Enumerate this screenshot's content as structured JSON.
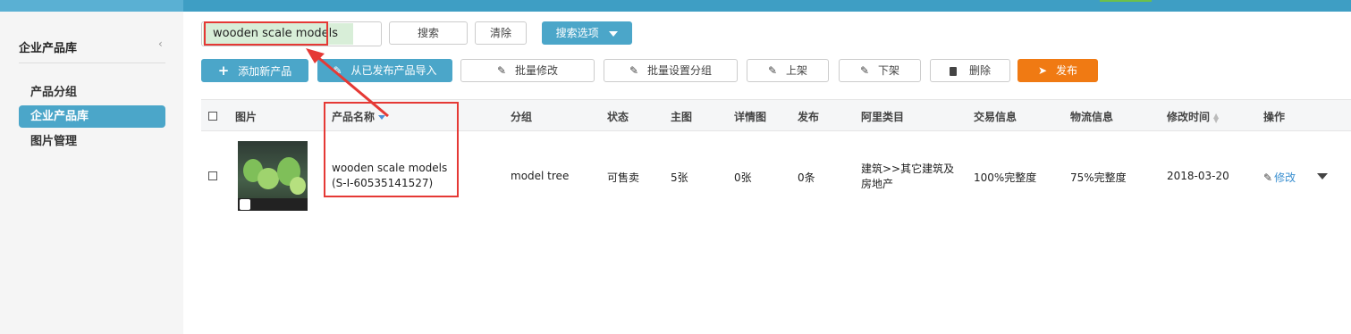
{
  "sidebar": {
    "title": "企业产品库",
    "collapse_icon": "‹",
    "items": [
      {
        "label": "产品分组",
        "active": false
      },
      {
        "label": "企业产品库",
        "active": true
      },
      {
        "label": "图片管理",
        "active": false
      }
    ]
  },
  "search": {
    "value": "wooden scale models",
    "search_label": "搜索",
    "clear_label": "清除",
    "options_label": "搜索选项"
  },
  "toolbar": {
    "add_label": "添加新产品",
    "import_label": "从已发布产品导入",
    "batch_edit_label": "批量修改",
    "batch_group_label": "批量设置分组",
    "list_label": "上架",
    "delist_label": "下架",
    "delete_label": "删除",
    "publish_label": "发布"
  },
  "table": {
    "headers": {
      "image": "图片",
      "name": "产品名称",
      "group": "分组",
      "status": "状态",
      "main_img": "主图",
      "detail_img": "详情图",
      "publish": "发布",
      "category": "阿里类目",
      "trade": "交易信息",
      "logistics": "物流信息",
      "modified": "修改时间",
      "action": "操作"
    },
    "rows": [
      {
        "name": "wooden scale models",
        "code": "(S-I-60535141527)",
        "group": "model tree",
        "status": "可售卖",
        "main_img": "5张",
        "detail_img": "0张",
        "publish": "0条",
        "category_line1": "建筑>>其它建筑及",
        "category_line2": "房地产",
        "trade": "100%完整度",
        "logistics": "75%完整度",
        "modified": "2018-03-20",
        "edit_label": "修改"
      }
    ]
  },
  "colors": {
    "accent": "#4ba6c9",
    "publish": "#f07a13",
    "highlight": "#e53935",
    "link": "#3a8fd0"
  }
}
